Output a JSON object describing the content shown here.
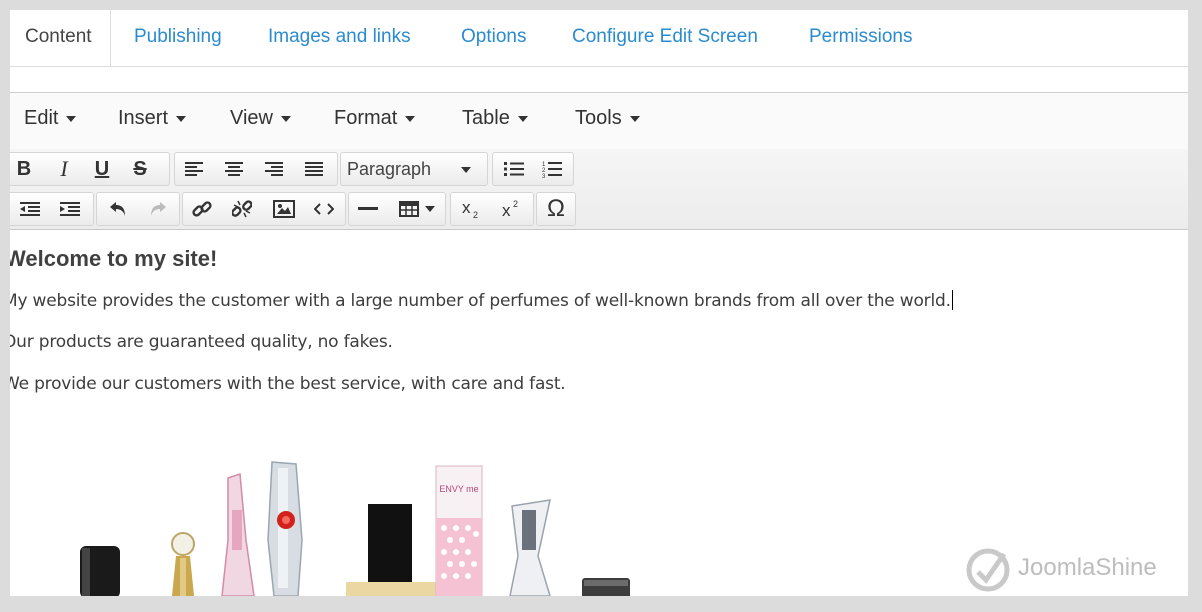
{
  "tabs": [
    {
      "label": "Content",
      "active": true
    },
    {
      "label": "Publishing"
    },
    {
      "label": "Images and links"
    },
    {
      "label": "Options"
    },
    {
      "label": "Configure Edit Screen"
    },
    {
      "label": "Permissions"
    }
  ],
  "menubar": {
    "items": [
      "Edit",
      "Insert",
      "View",
      "Format",
      "Table",
      "Tools"
    ]
  },
  "toolbar": {
    "row1": [
      "bold-icon",
      "italic-icon",
      "underline-icon",
      "strikethrough-icon",
      "align-left-icon",
      "align-center-icon",
      "align-right-icon",
      "align-justify-icon",
      "bullet-list-icon",
      "numbered-list-icon"
    ],
    "format_select": "Paragraph",
    "row2": [
      "outdent-icon",
      "indent-icon",
      "undo-icon",
      "redo-icon",
      "link-icon",
      "unlink-icon",
      "image-icon",
      "code-icon",
      "horizontal-rule-icon",
      "table-icon",
      "subscript-icon",
      "superscript-icon",
      "special-character-icon"
    ],
    "glyphs": {
      "bold": "B",
      "italic": "I",
      "underline": "U",
      "strike": "S",
      "omega": "Ω"
    }
  },
  "content": {
    "heading": "Welcome to my site!",
    "paragraphs": [
      "My website provides the customer with a large number of perfumes of well-known brands from all over the world.",
      "Our products are guaranteed quality, no fakes.",
      "We provide our customers with the best service, with care and fast."
    ],
    "image_label": "ENVY me"
  },
  "watermark": "JoomlaShine",
  "colors": {
    "accent": "#2a8bd1",
    "text": "#3d3d3d",
    "background": "#dcdcdc"
  }
}
